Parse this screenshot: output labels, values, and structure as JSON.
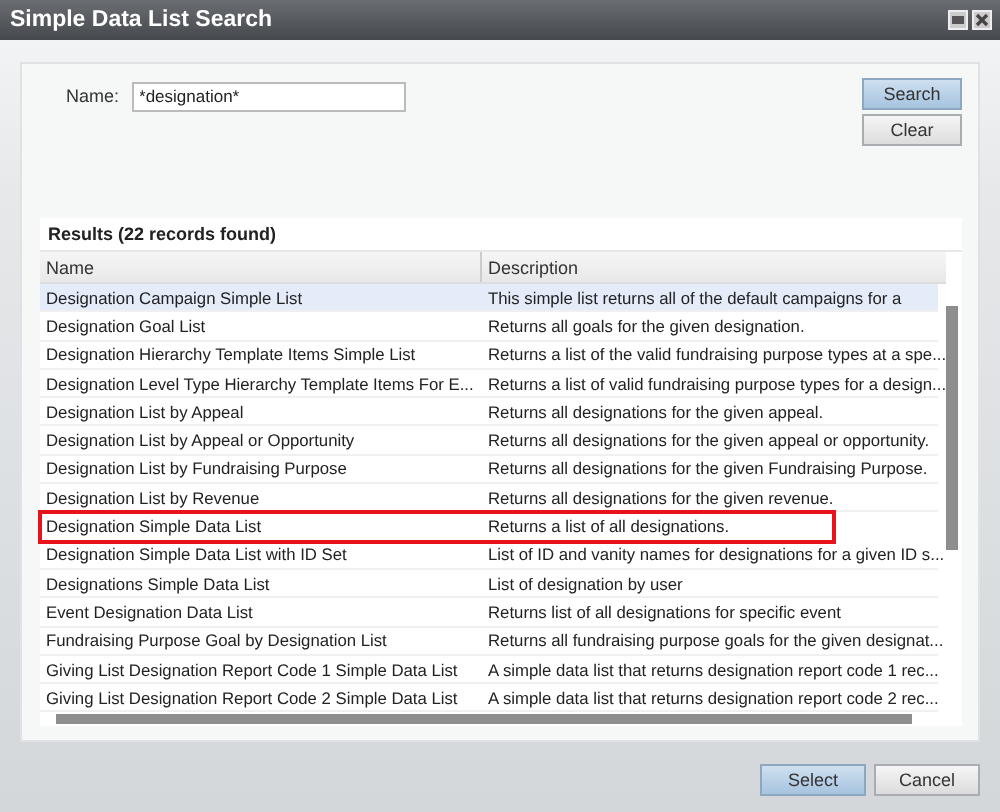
{
  "window": {
    "title": "Simple Data List Search"
  },
  "search": {
    "label": "Name:",
    "value": "*designation*",
    "buttons": [
      {
        "label": "Search",
        "kind": "primary"
      },
      {
        "label": "Clear",
        "kind": "normal"
      }
    ]
  },
  "results": {
    "title": "Results (22 records found)",
    "columns": [
      "Name",
      "Description"
    ],
    "rows": [
      {
        "name": "Designation Campaign Simple List",
        "description": "This simple list returns all of the default campaigns for a",
        "selected": true,
        "outlined": false
      },
      {
        "name": "Designation Goal List",
        "description": "Returns all goals for the given designation.",
        "selected": false,
        "outlined": false
      },
      {
        "name": "Designation Hierarchy Template Items Simple List",
        "description": "Returns a list of the valid fundraising purpose types at a spe...",
        "selected": false,
        "outlined": false
      },
      {
        "name": "Designation Level Type Hierarchy Template Items For E...",
        "description": "Returns a list of valid fundraising purpose types for a design...",
        "selected": false,
        "outlined": false
      },
      {
        "name": "Designation List by Appeal",
        "description": "Returns all designations for the given appeal.",
        "selected": false,
        "outlined": false
      },
      {
        "name": "Designation List by Appeal or Opportunity",
        "description": "Returns all designations for the given appeal or opportunity.",
        "selected": false,
        "outlined": false
      },
      {
        "name": "Designation List by Fundraising Purpose",
        "description": "Returns all designations for the given Fundraising Purpose.",
        "selected": false,
        "outlined": false
      },
      {
        "name": "Designation List by Revenue",
        "description": "Returns all designations for the given revenue.",
        "selected": false,
        "outlined": false
      },
      {
        "name": "Designation Simple Data List",
        "description": "Returns a list of all designations.",
        "selected": false,
        "outlined": true
      },
      {
        "name": "Designation Simple Data List with ID Set",
        "description": "List of ID and vanity names for designations for a given ID s...",
        "selected": false,
        "outlined": false
      },
      {
        "name": "Designations Simple Data List",
        "description": "List of designation by user",
        "selected": false,
        "outlined": false
      },
      {
        "name": "Event Designation Data List",
        "description": "Returns list of all designations for specific event",
        "selected": false,
        "outlined": false
      },
      {
        "name": "Fundraising Purpose Goal by Designation List",
        "description": "Returns all fundraising purpose goals for the given designat...",
        "selected": false,
        "outlined": false
      },
      {
        "name": "Giving List Designation Report Code 1 Simple Data List",
        "description": "A simple data list that returns designation report code 1 rec...",
        "selected": false,
        "outlined": false
      },
      {
        "name": "Giving List Designation Report Code 2 Simple Data List",
        "description": "A simple data list that returns designation report code 2 rec...",
        "selected": false,
        "outlined": false
      }
    ]
  },
  "footer": {
    "buttons": [
      {
        "label": "Select",
        "kind": "primary"
      },
      {
        "label": "Cancel",
        "kind": "normal"
      }
    ]
  }
}
